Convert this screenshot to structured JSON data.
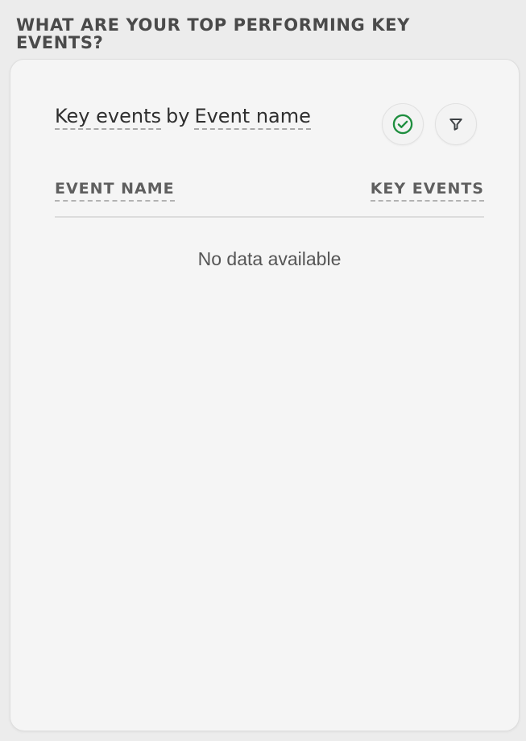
{
  "section": {
    "heading": "WHAT ARE YOUR TOP PERFORMING KEY EVENTS?"
  },
  "card": {
    "title": {
      "metric": "Key events",
      "connector": "by",
      "dimension": "Event name"
    },
    "icons": {
      "compare": "check-circle-icon",
      "filter": "filter-icon"
    },
    "colors": {
      "check_icon": "#1e8e3e",
      "filter_icon": "#3c4043"
    },
    "table": {
      "columns": [
        "EVENT NAME",
        "KEY EVENTS"
      ],
      "rows": []
    },
    "empty_message": "No data available"
  }
}
